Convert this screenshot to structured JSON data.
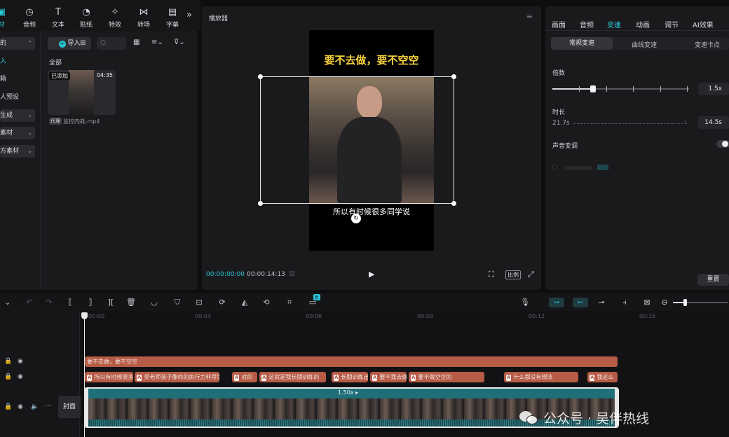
{
  "toolbar": {
    "tabs": [
      {
        "icon": "▣",
        "label": "材",
        "active": true
      },
      {
        "icon": "◷",
        "label": "音频"
      },
      {
        "icon": "T",
        "label": "文本"
      },
      {
        "icon": "◔",
        "label": "贴纸"
      },
      {
        "icon": "✧",
        "label": "特效"
      },
      {
        "icon": "⋈",
        "label": "转场"
      },
      {
        "icon": "▤",
        "label": "字幕"
      }
    ],
    "more": "»"
  },
  "left_panel": {
    "sidebar": [
      {
        "label": "的",
        "caret": "⌃",
        "box": true
      },
      {
        "label": "入"
      },
      {
        "label": "箱"
      },
      {
        "label": "人预设"
      },
      {
        "label": "生成",
        "caret": "⌄",
        "box": true
      },
      {
        "label": "素材",
        "caret": "⌄",
        "box": true
      },
      {
        "label": "方素材",
        "caret": "⌄",
        "box": true
      }
    ],
    "import_label": "导入",
    "all_label": "全部",
    "media": {
      "added_badge": "已添加",
      "duration": "04:35",
      "proxy_tag": "代理",
      "filename": "监控内耗.mp4"
    }
  },
  "player": {
    "title": "播放器",
    "top_caption": "要不去做，要不空空",
    "subtitle": "所以有时候很多同学说",
    "time_current": "00:00:00:00",
    "time_total": "00:00:14:13",
    "ratio_label": "比例"
  },
  "right_panel": {
    "tabs": [
      "画面",
      "音频",
      "变速",
      "动画",
      "调节",
      "AI效果"
    ],
    "active_tab": "变速",
    "subtabs": [
      "常规变速",
      "曲线变速",
      "变速卡点"
    ],
    "speed_label": "倍数",
    "speed_value": "1.5x",
    "duration_label": "时长",
    "duration_orig": "21.7s",
    "duration_value": "14.5s",
    "pitch_label": "声音变调",
    "reset_label": "重置"
  },
  "timeline": {
    "new_badge": "新",
    "ruler": [
      "00:00",
      "00:03",
      "00:06",
      "00:09",
      "00:12",
      "00:15"
    ],
    "title_clip": "要不去做，要不空空",
    "subtitle_clips": [
      "所以有时候很多",
      "吴老师孩子像你的执行力非常强",
      "对的",
      "这就是我长期训练的",
      "长期训练出",
      "要不我去做",
      "要不做空空的",
      "什么都没有想法",
      "我这么"
    ],
    "speed_badge": "1.50x ▸",
    "cover_label": "封面"
  },
  "watermark": {
    "text": "公众号 · 吴伴热线"
  }
}
